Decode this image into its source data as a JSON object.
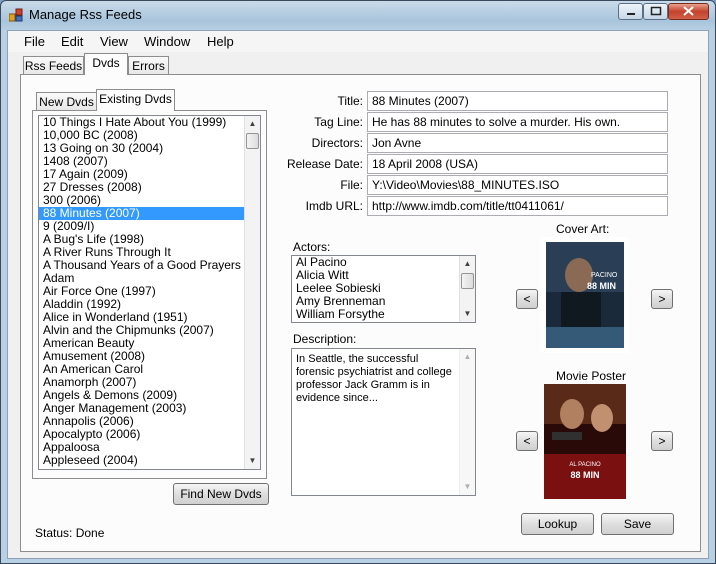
{
  "window": {
    "title": "Manage Rss Feeds"
  },
  "menu": [
    "File",
    "Edit",
    "View",
    "Window",
    "Help"
  ],
  "tabs": {
    "rss": "Rss Feeds",
    "dvds": "Dvds",
    "errors": "Errors"
  },
  "subtabs": {
    "new": "New Dvds",
    "existing": "Existing Dvds"
  },
  "dvd_list": [
    "10 Things I Hate About You (1999)",
    "10,000 BC (2008)",
    "13 Going on 30 (2004)",
    "1408 (2007)",
    "17 Again (2009)",
    "27 Dresses (2008)",
    "300 (2006)",
    "88 Minutes (2007)",
    "9 (2009/I)",
    "A Bug's Life (1998)",
    "A River Runs Through It",
    "A Thousand Years of a Good Prayers",
    "Adam",
    "Air Force One (1997)",
    "Aladdin (1992)",
    "Alice in Wonderland (1951)",
    "Alvin and the Chipmunks (2007)",
    "American Beauty",
    "Amusement (2008)",
    "An American Carol",
    "Anamorph (2007)",
    "Angels & Demons (2009)",
    "Anger Management (2003)",
    "Annapolis (2006)",
    "Apocalypto (2006)",
    "Appaloosa",
    "Appleseed (2004)"
  ],
  "selected_index": 7,
  "buttons": {
    "find_new": "Find New Dvds",
    "lookup": "Lookup",
    "save": "Save",
    "prev": "<",
    "next": ">"
  },
  "fields": {
    "title": {
      "label": "Title:",
      "value": "88 Minutes (2007)"
    },
    "tagline": {
      "label": "Tag Line:",
      "value": "He has 88 minutes to solve a murder. His own."
    },
    "directors": {
      "label": "Directors:",
      "value": "Jon Avne"
    },
    "release": {
      "label": "Release Date:",
      "value": "18 April 2008 (USA)"
    },
    "file": {
      "label": "File:",
      "value": "Y:\\Video\\Movies\\88_MINUTES.ISO"
    },
    "imdb": {
      "label": "Imdb URL:",
      "value": "http://www.imdb.com/title/tt0411061/"
    }
  },
  "actors": {
    "label": "Actors:",
    "items": [
      "Al Pacino",
      "Alicia Witt",
      "Leelee Sobieski",
      "Amy Brenneman",
      "William Forsythe"
    ]
  },
  "description": {
    "label": "Description:",
    "text": "In Seattle, the successful forensic psychiatrist and college professor Jack Gramm is in evidence since..."
  },
  "cover_art": {
    "label": "Cover Art:",
    "poster_text": "PACINO 88 MINUTES"
  },
  "movie_poster": {
    "label": "Movie Poster",
    "poster_text": "AL PACINO 88 MINUTES"
  },
  "status": "Status: Done",
  "colors": {
    "selection": "#3399ff",
    "window_frame": "#a8c4dc"
  }
}
